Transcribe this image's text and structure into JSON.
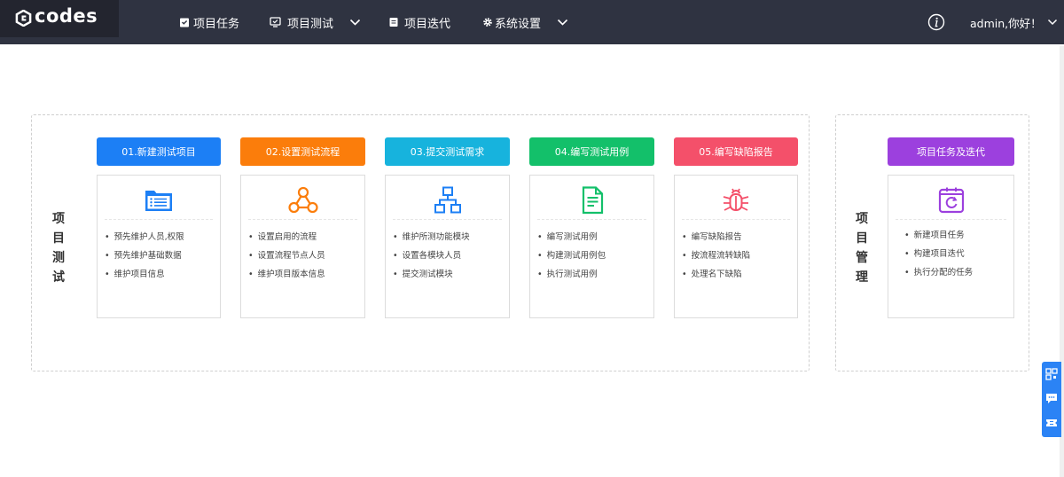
{
  "app": {
    "logo_text": "codes"
  },
  "nav": {
    "items": [
      {
        "label": "项目任务",
        "icon": "clipboard-icon"
      },
      {
        "label": "项目测试",
        "icon": "monitor-check-icon",
        "has_dropdown": true
      },
      {
        "label": "项目迭代",
        "icon": "document-icon"
      },
      {
        "label": "系统设置",
        "icon": "gear-icon",
        "has_dropdown": true
      }
    ],
    "user_greeting": "admin,你好！"
  },
  "testing": {
    "title_chars": [
      "项",
      "目",
      "测",
      "试"
    ],
    "steps": [
      {
        "title": "01.新建测试项目",
        "color": "#1c7ff5",
        "icon": "folder-list-icon",
        "items": [
          "预先维护人员,权限",
          "预先维护基础数据",
          "维护项目信息"
        ]
      },
      {
        "title": "02.设置测试流程",
        "color": "#fb7d0b",
        "icon": "flow-nodes-icon",
        "items": [
          "设置启用的流程",
          "设置流程节点人员",
          "维护项目版本信息"
        ]
      },
      {
        "title": "03.提交测试需求",
        "color": "#17b3dd",
        "icon": "hierarchy-icon",
        "items": [
          "维护所测功能模块",
          "设置各模块人员",
          "提交测试模块"
        ]
      },
      {
        "title": "04.编写测试用例",
        "color": "#13c06a",
        "icon": "document-lines-icon",
        "items": [
          "编写测试用例",
          "构建测试用例包",
          "执行测试用例"
        ]
      },
      {
        "title": "05.编写缺陷报告",
        "color": "#f4506a",
        "icon": "bug-icon",
        "items": [
          "编写缺陷报告",
          "按流程流转缺陷",
          "处理名下缺陷"
        ]
      }
    ]
  },
  "management": {
    "title_chars": [
      "项",
      "目",
      "管",
      "理"
    ],
    "card": {
      "title": "项目任务及迭代",
      "color": "#9c40de",
      "icon": "cycle-box-icon",
      "items": [
        "新建项目任务",
        "构建项目迭代",
        "执行分配的任务"
      ]
    }
  }
}
